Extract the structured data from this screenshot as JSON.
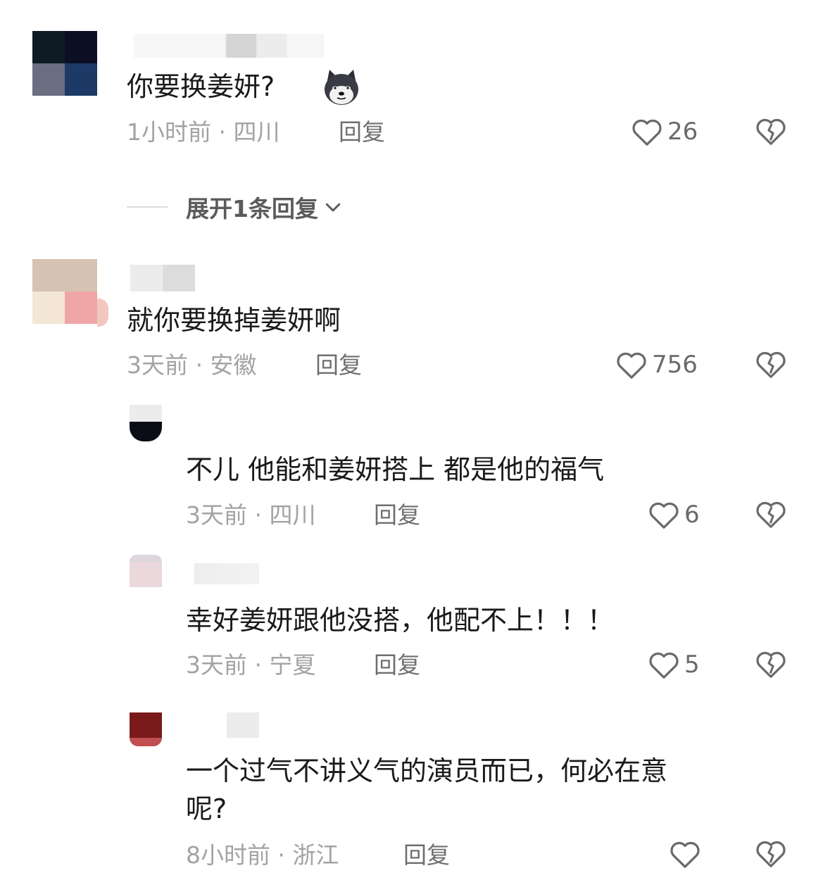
{
  "comments": [
    {
      "text": "你要换姜妍?",
      "emoji_icon": "husky-dog-emoji",
      "time": "1小时前",
      "location": "四川",
      "reply_label": "回复",
      "likes": "26",
      "expand_label": "展开1条回复"
    },
    {
      "text": "就你要换掉姜妍啊",
      "time": "3天前",
      "location": "安徽",
      "reply_label": "回复",
      "likes": "756",
      "replies": [
        {
          "text": "不儿 他能和姜妍搭上 都是他的福气",
          "time": "3天前",
          "location": "四川",
          "reply_label": "回复",
          "likes": "6"
        },
        {
          "text": "幸好姜妍跟他没搭，他配不上！！！",
          "time": "3天前",
          "location": "宁夏",
          "reply_label": "回复",
          "likes": "5"
        },
        {
          "text_line1": "一个过气不讲义气的演员而已，何必在意",
          "text_line2": "呢?",
          "time": "8小时前",
          "location": "浙江",
          "reply_label": "回复",
          "likes": ""
        }
      ]
    }
  ],
  "meta_separator": " · ",
  "icons": {
    "like": "heart-outline-icon",
    "dislike": "broken-heart-icon",
    "expand": "chevron-down-icon"
  }
}
